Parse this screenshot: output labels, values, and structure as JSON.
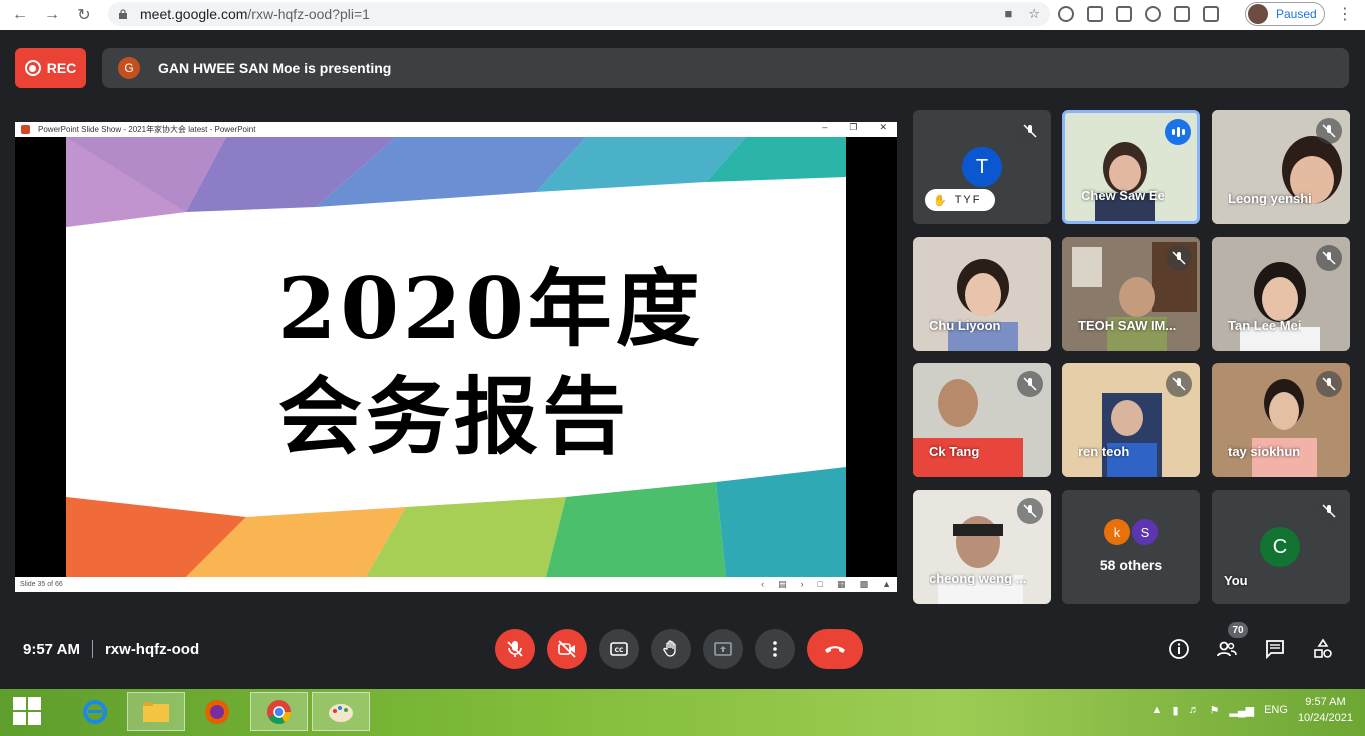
{
  "browser": {
    "url_domain": "meet.google.com",
    "url_path": "/rxw-hqfz-ood?pli=1",
    "profile_status": "Paused"
  },
  "meet": {
    "rec_label": "REC",
    "presenter_initial": "G",
    "presenting_text": "GAN HWEE SAN Moe is presenting",
    "meeting_time": "9:57 AM",
    "meeting_code": "rxw-hqfz-ood",
    "participant_count": "70"
  },
  "presentation": {
    "window_title": "PowerPoint Slide Show  -  2021年家协大会 latest - PowerPoint",
    "slide_line1": "2020年度",
    "slide_line2": "会务报告",
    "slide_counter": "Slide 35 of 66"
  },
  "participants": [
    {
      "name": "TYF",
      "initial": "T",
      "color": "#0b57d0",
      "hand_raised": true,
      "muted": true
    },
    {
      "name": "Chew Saw Ee",
      "speaking": true
    },
    {
      "name": "Leong yenshi",
      "muted": true
    },
    {
      "name": "Chu Liyoon",
      "muted": false
    },
    {
      "name": "TEOH SAW IM...",
      "muted": true
    },
    {
      "name": "Tan Lee Mei",
      "muted": true
    },
    {
      "name": "Ck Tang",
      "muted": true
    },
    {
      "name": "ren teoh",
      "muted": true
    },
    {
      "name": "tay siokhun",
      "muted": true
    },
    {
      "name": "cheong weng ...",
      "muted": true
    },
    {
      "name": "58 others",
      "initials": [
        "k",
        "S"
      ]
    },
    {
      "name": "You",
      "initial": "C",
      "color": "#137333",
      "muted": true
    }
  ],
  "taskbar": {
    "lang": "ENG",
    "time": "9:57 AM",
    "date": "10/24/2021"
  },
  "colors": {
    "meet_bg": "#202124",
    "tile_bg": "#3c4043",
    "danger": "#ea4335",
    "accent": "#1a73e8"
  }
}
